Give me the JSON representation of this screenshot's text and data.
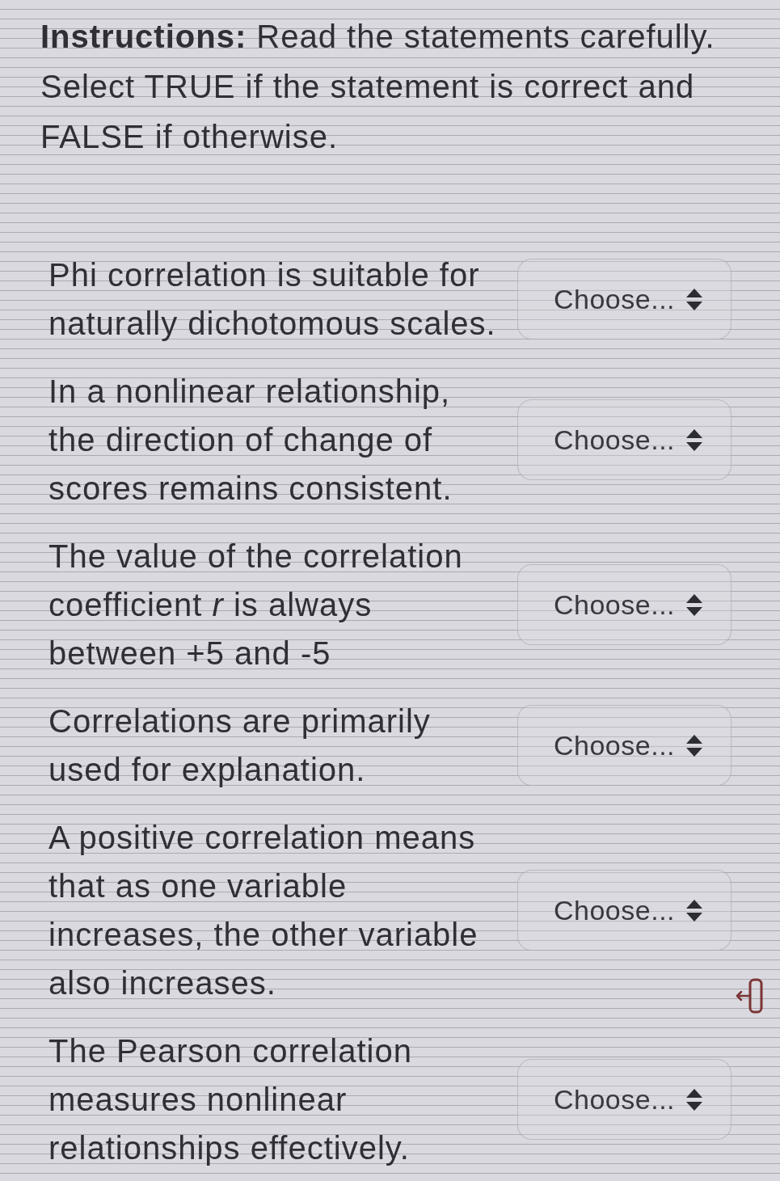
{
  "instructions": "**Instructions:** Read the statements carefully.\nSelect TRUE if the statement is correct and\nFALSE if otherwise.",
  "questions": [
    {
      "statement": "Phi correlation is suitable for\nnaturally dichotomous scales.",
      "dropdown": "Choose...",
      "side_icon": false
    },
    {
      "statement": "In a nonlinear relationship,\nthe direction of change of\nscores remains consistent.",
      "dropdown": "Choose...",
      "side_icon": false
    },
    {
      "statement": "The value of the correlation\ncoefficient *r* is always\nbetween +5 and -5",
      "dropdown": "Choose...",
      "side_icon": false
    },
    {
      "statement": "Correlations are primarily\nused for explanation.",
      "dropdown": "Choose...",
      "side_icon": false
    },
    {
      "statement": "A positive correlation means\nthat as one variable\nincreases, the other variable\nalso increases.",
      "dropdown": "Choose...",
      "side_icon": true
    },
    {
      "statement": "The Pearson correlation\nmeasures nonlinear\nrelationships effectively.",
      "dropdown": "Choose...",
      "side_icon": false
    }
  ]
}
